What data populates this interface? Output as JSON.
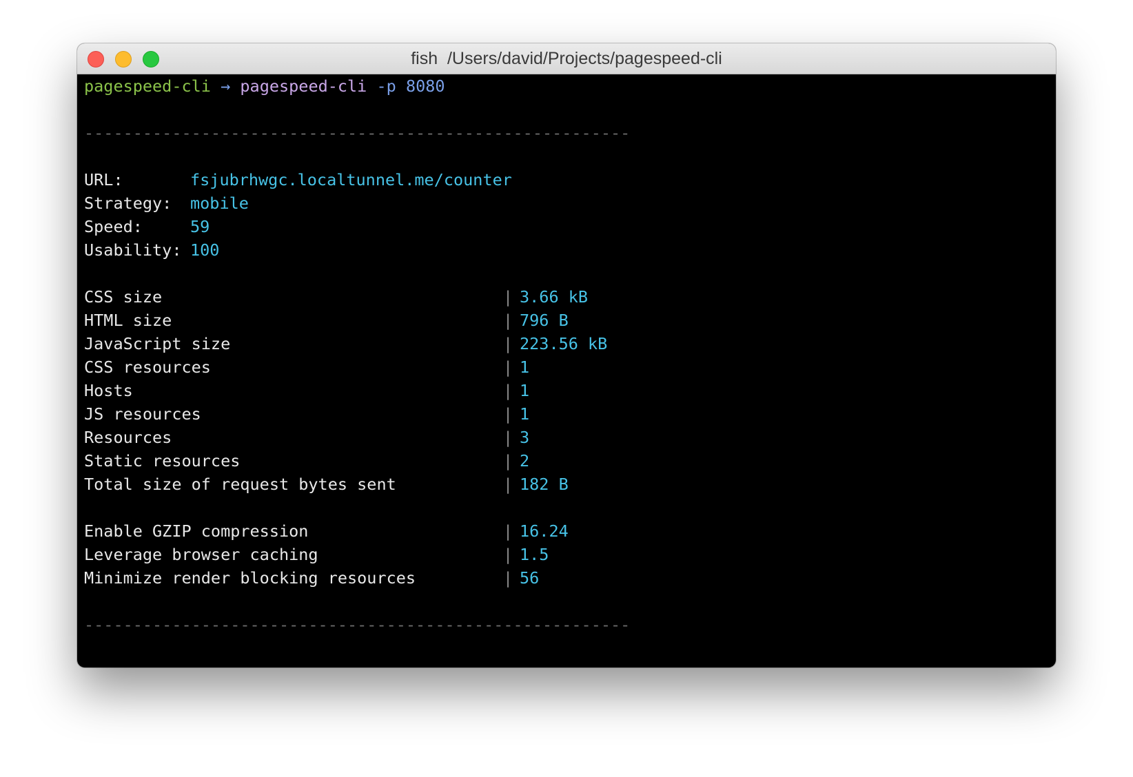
{
  "window": {
    "title": "fish  /Users/david/Projects/pagespeed-cli"
  },
  "prompt": {
    "cwd": "pagespeed-cli",
    "arrow": "→",
    "command": "pagespeed-cli",
    "flag": "-p",
    "argument": "8080"
  },
  "rule": "--------------------------------------------------------",
  "summary": [
    {
      "label": "URL:",
      "value": "fsjubrhwgc.localtunnel.me/counter"
    },
    {
      "label": "Strategy:",
      "value": "mobile"
    },
    {
      "label": "Speed:",
      "value": "59"
    },
    {
      "label": "Usability:",
      "value": "100"
    }
  ],
  "stats": [
    {
      "label": "CSS size",
      "value": "3.66 kB"
    },
    {
      "label": "HTML size",
      "value": "796 B"
    },
    {
      "label": "JavaScript size",
      "value": "223.56 kB"
    },
    {
      "label": "CSS resources",
      "value": "1"
    },
    {
      "label": "Hosts",
      "value": "1"
    },
    {
      "label": "JS resources",
      "value": "1"
    },
    {
      "label": "Resources",
      "value": "3"
    },
    {
      "label": "Static resources",
      "value": "2"
    },
    {
      "label": "Total size of request bytes sent",
      "value": "182 B"
    }
  ],
  "rules": [
    {
      "label": "Enable GZIP compression",
      "value": "16.24"
    },
    {
      "label": "Leverage browser caching",
      "value": "1.5"
    },
    {
      "label": "Minimize render blocking resources",
      "value": "56"
    }
  ],
  "separator": "|",
  "colors": {
    "prompt_cwd": "#8bc34a",
    "prompt_command": "#c9a7e8",
    "prompt_arg": "#7a9fe8",
    "value": "#47c2e6",
    "background": "#000000"
  }
}
